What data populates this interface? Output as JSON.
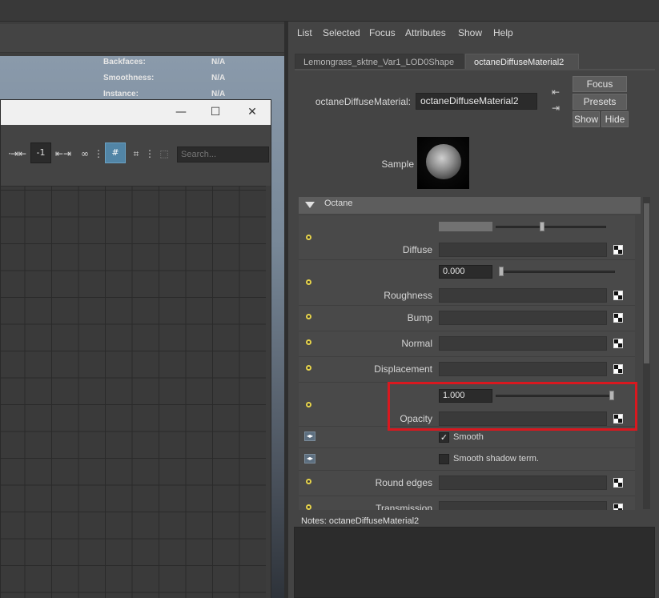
{
  "viewport_hud": {
    "rows": [
      {
        "label": "Backfaces:",
        "value": "N/A"
      },
      {
        "label": "Smoothness:",
        "value": "N/A"
      },
      {
        "label": "Instance:",
        "value": "N/A"
      }
    ]
  },
  "editor_window": {
    "controls": {
      "minimize": "—",
      "maximize": "☐",
      "close": "✕"
    },
    "toolbar": {
      "frame_field": "-1",
      "search_placeholder": "Search..."
    }
  },
  "attribute_editor": {
    "menu": [
      "List",
      "Selected",
      "Focus",
      "Attributes",
      "Show",
      "Help"
    ],
    "tabs": [
      "Lemongrass_sktne_Var1_LOD0Shape",
      "octaneDiffuseMaterial2"
    ],
    "node_type_label": "octaneDiffuseMaterial:",
    "node_name": "octaneDiffuseMaterial2",
    "buttons": {
      "focus": "Focus",
      "presets": "Presets",
      "show": "Show",
      "hide": "Hide"
    },
    "sample_label": "Sample",
    "section_title": "Octane",
    "attributes": {
      "diffuse": {
        "label": "Diffuse",
        "slider_fraction": 0.42
      },
      "roughness": {
        "label": "Roughness",
        "value": "0.000",
        "slider_fraction": 0.0
      },
      "bump": {
        "label": "Bump"
      },
      "normal": {
        "label": "Normal"
      },
      "displacement": {
        "label": "Displacement"
      },
      "opacity": {
        "label": "Opacity",
        "value": "1.000",
        "slider_fraction": 1.0
      },
      "smooth": {
        "label": "Smooth",
        "checked": true
      },
      "smooth_shadow": {
        "label": "Smooth shadow term.",
        "checked": false
      },
      "round_edges": {
        "label": "Round edges"
      },
      "transmission": {
        "label": "Transmission"
      }
    },
    "notes_label": "Notes:  octaneDiffuseMaterial2",
    "colors": {
      "highlight": "#d9181f",
      "map_dot": "#e6d34a",
      "active_tool": "#5285a6"
    }
  }
}
